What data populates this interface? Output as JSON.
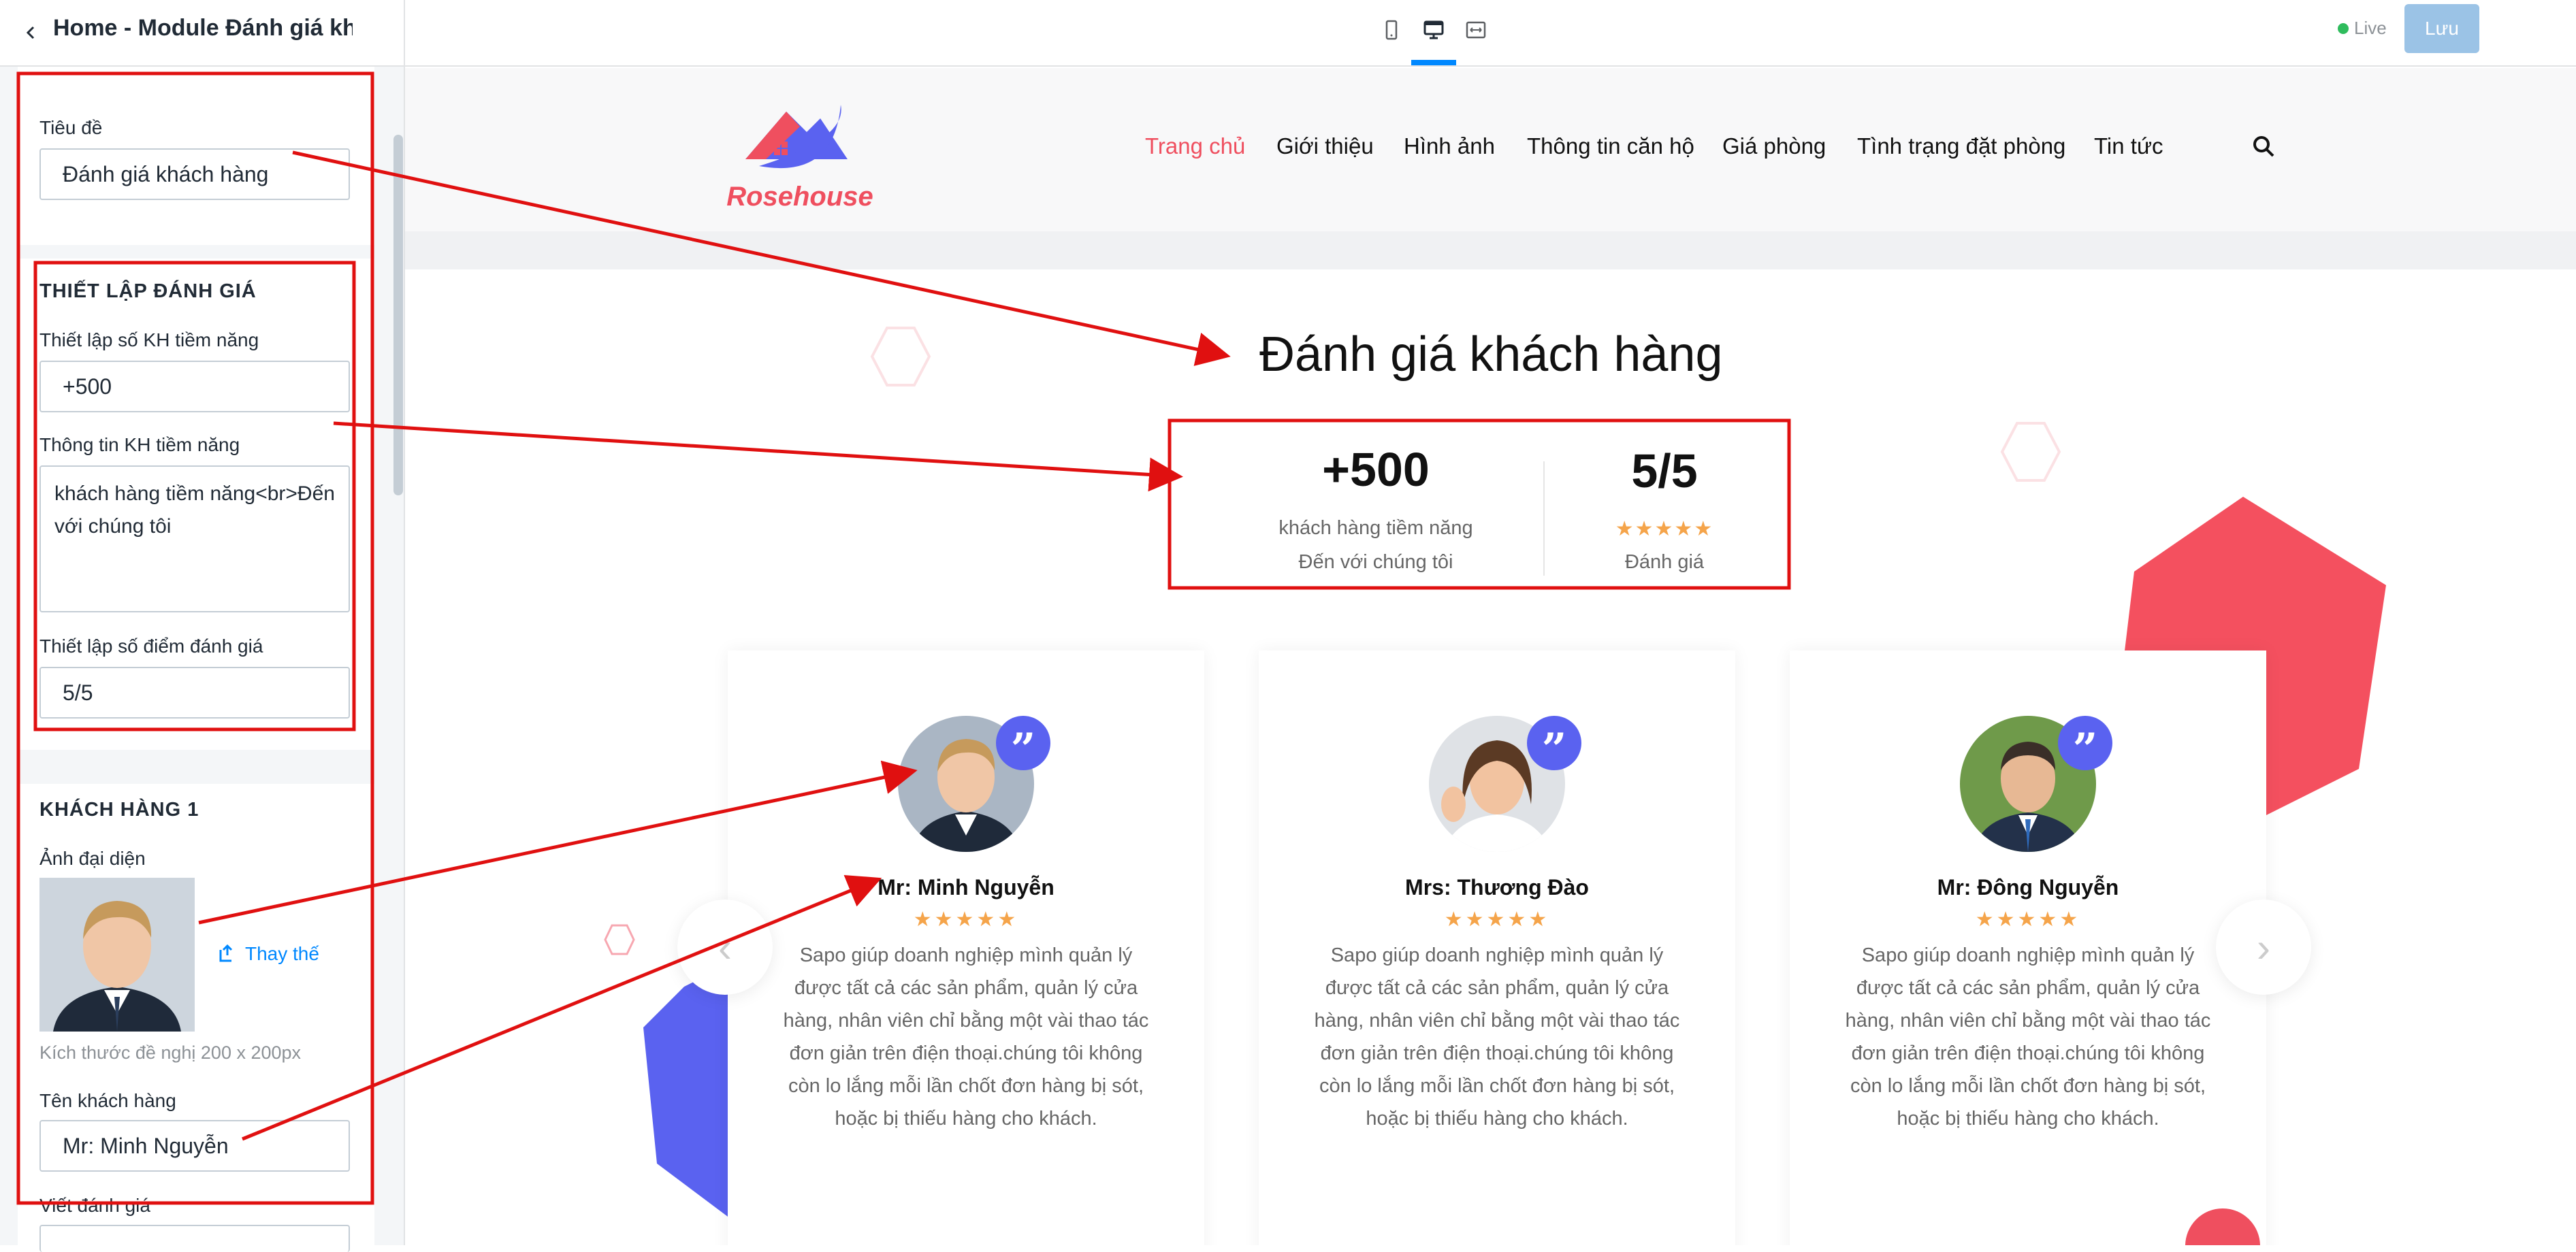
{
  "editor": {
    "module_title": "Home - Module Đánh giá kh...",
    "live_label": "Live",
    "save_label": "Lưu"
  },
  "settings": {
    "title_label": "Tiêu đề",
    "title_value": "Đánh giá khách hàng",
    "review_section_heading": "THIẾT LẬP ĐÁNH GIÁ",
    "potential_count_label": "Thiết lập số KH tiềm năng",
    "potential_count_value": "+500",
    "potential_info_label": "Thông tin KH tiềm năng",
    "potential_info_value": "khách hàng tiềm năng<br>Đến với chúng tôi",
    "score_label": "Thiết lập số điểm đánh giá",
    "score_value": "5/5",
    "customer_section_heading": "KHÁCH HÀNG 1",
    "avatar_label": "Ảnh đại diện",
    "replace_label": "Thay thế",
    "size_hint": "Kích thước đề nghị 200 x 200px",
    "customer_name_label": "Tên khách hàng",
    "customer_name_value": "Mr: Minh Nguyễn",
    "write_review_label": "Viết đánh giá"
  },
  "site": {
    "brand": "Rosehouse",
    "nav": [
      {
        "label": "Trang chủ",
        "active": true
      },
      {
        "label": "Giới thiệu",
        "active": false
      },
      {
        "label": "Hình ảnh",
        "active": false
      },
      {
        "label": "Thông tin căn hộ",
        "active": false
      },
      {
        "label": "Giá phòng",
        "active": false
      },
      {
        "label": "Tình trạng đặt phòng",
        "active": false
      },
      {
        "label": "Tin tức",
        "active": false
      }
    ],
    "section_title": "Đánh giá khách hàng",
    "stats": {
      "count_value": "+500",
      "count_line1": "khách hàng tiềm năng",
      "count_line2": "Đến với chúng tôi",
      "score_value": "5/5",
      "score_label": "Đánh giá",
      "stars": "★★★★★"
    },
    "reviews": [
      {
        "name": "Mr: Minh Nguyễn",
        "stars": "★★★★★",
        "text": "Sapo giúp doanh nghiệp mình quản lý được tất cả các sản phẩm, quản lý cửa hàng, nhân viên chỉ bằng một vài thao tác đơn giản trên điện thoại.chúng tôi không còn lo lắng mỗi lần chốt đơn hàng bị sót, hoặc bị thiếu hàng cho khách."
      },
      {
        "name": "Mrs: Thương Đào",
        "stars": "★★★★★",
        "text": "Sapo giúp doanh nghiệp mình quản lý được tất cả các sản phẩm, quản lý cửa hàng, nhân viên chỉ bằng một vài thao tác đơn giản trên điện thoại.chúng tôi không còn lo lắng mỗi lần chốt đơn hàng bị sót, hoặc bị thiếu hàng cho khách."
      },
      {
        "name": "Mr: Đông Nguyễn",
        "stars": "★★★★★",
        "text": "Sapo giúp doanh nghiệp mình quản lý được tất cả các sản phẩm, quản lý cửa hàng, nhân viên chỉ bằng một vài thao tác đơn giản trên điện thoại.chúng tôi không còn lo lắng mỗi lần chốt đơn hàng bị sót, hoặc bị thiếu hàng cho khách."
      }
    ],
    "quote_glyph": "”"
  },
  "icons": {
    "back": "chevron-left-icon",
    "mobile": "mobile-device-icon",
    "desktop": "desktop-device-icon",
    "fullwidth": "fullwidth-device-icon",
    "search": "search-icon",
    "replace": "upload-icon",
    "quote": "quote-icon"
  },
  "colors": {
    "accent_blue": "#0088ff",
    "brand_red": "#ef4f5f",
    "star_orange": "#f5a44a",
    "quote_purple": "#5a62f0",
    "annotation_red": "#e01010"
  }
}
